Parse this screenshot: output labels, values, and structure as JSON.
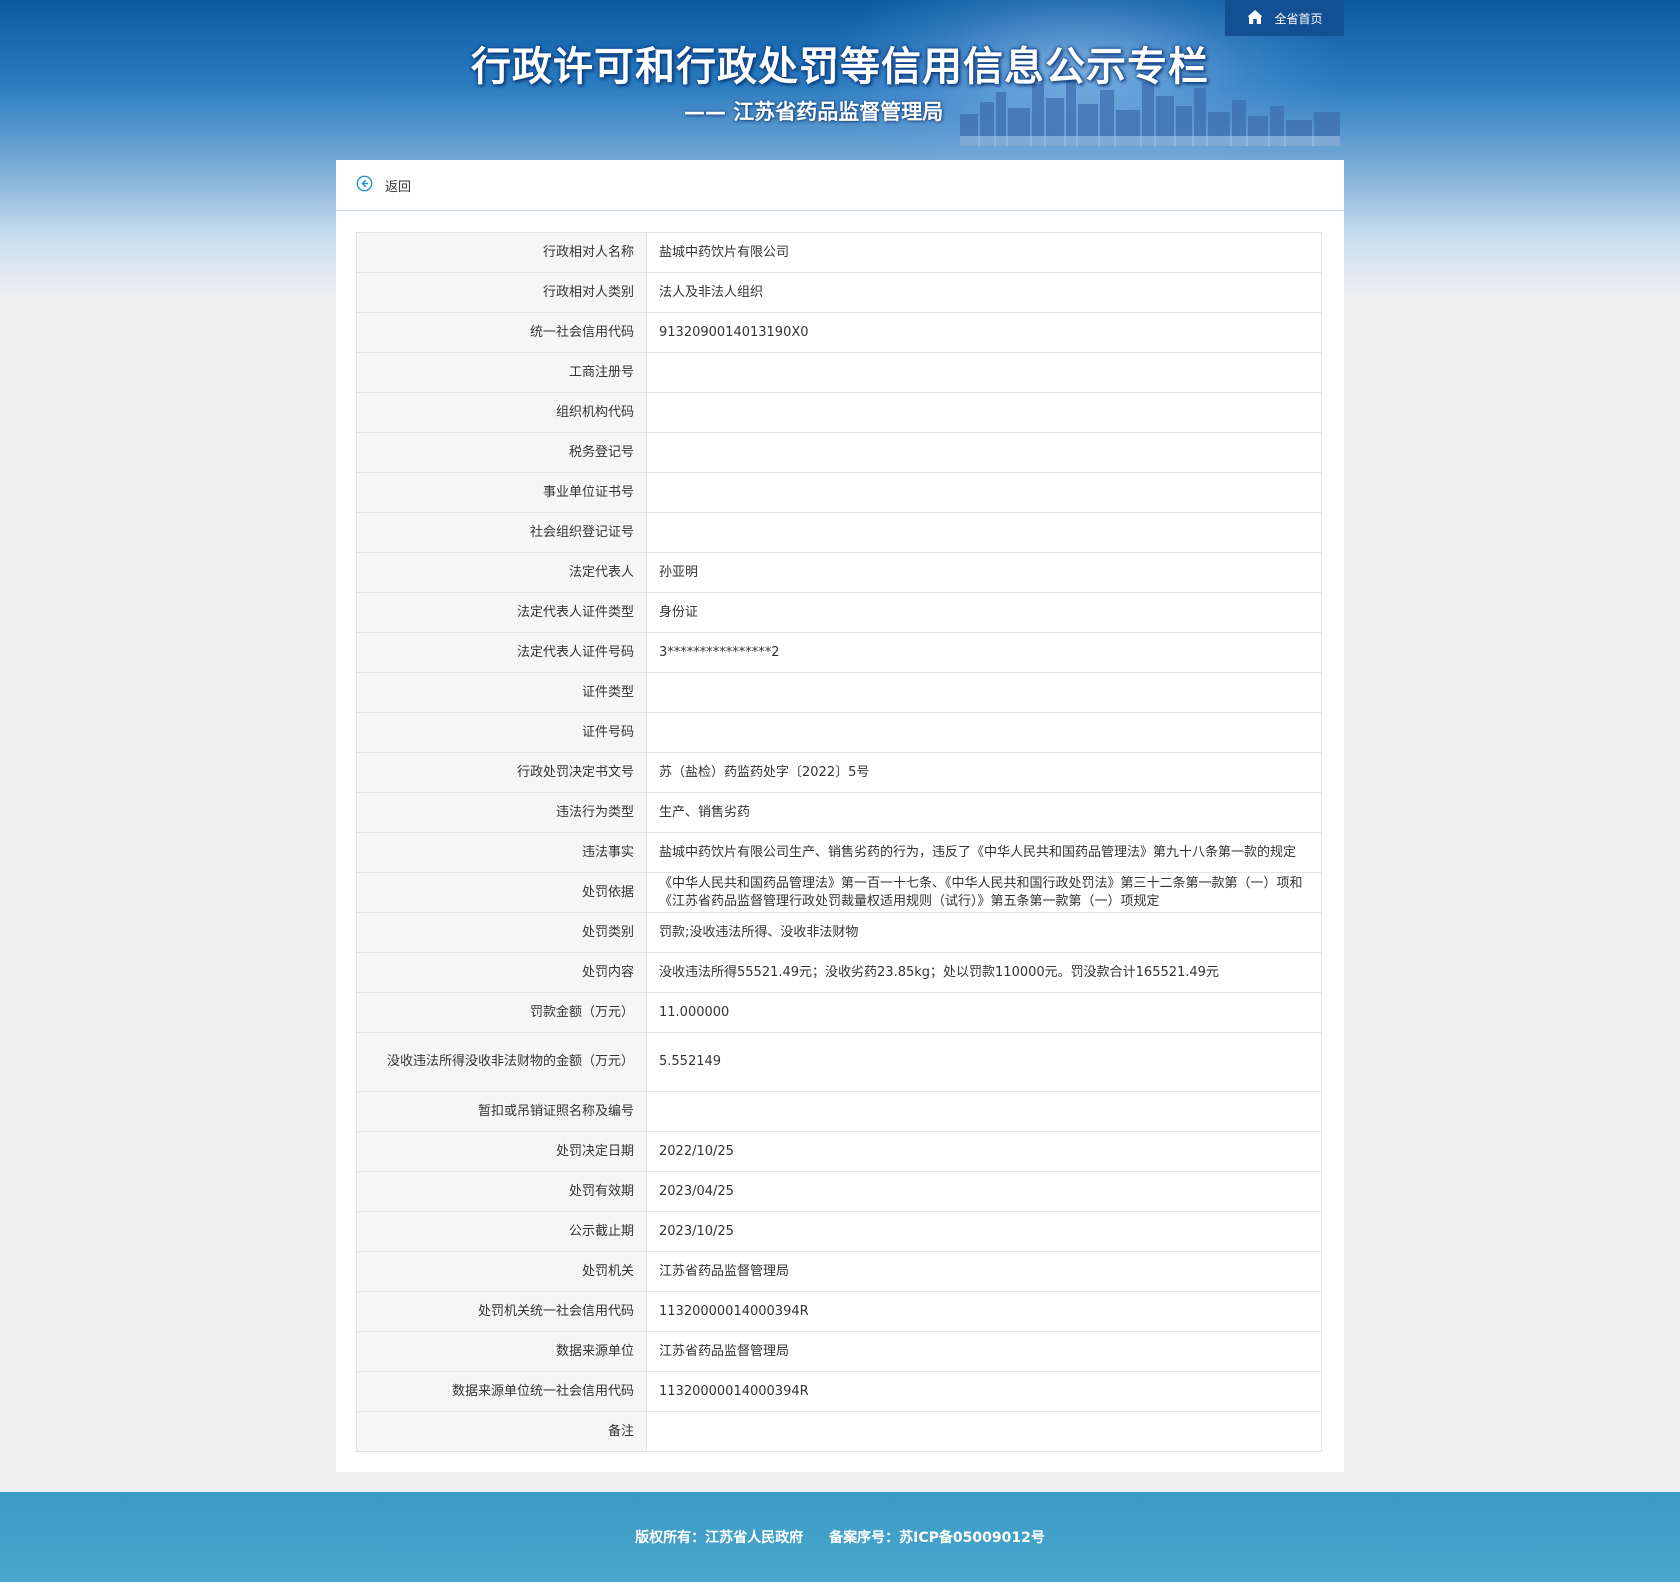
{
  "header": {
    "title": "行政许可和行政处罚等信用信息公示专栏",
    "subtitle": "—— 江苏省药品监督管理局",
    "home_label": "全省首页",
    "home_icon": "home-icon"
  },
  "back": {
    "label": "返回",
    "icon": "back-arrow-icon"
  },
  "rows": [
    {
      "label": "行政相对人名称",
      "value": "盐城中药饮片有限公司"
    },
    {
      "label": "行政相对人类别",
      "value": "法人及非法人组织"
    },
    {
      "label": "统一社会信用代码",
      "value": "9132090014013190X0"
    },
    {
      "label": "工商注册号",
      "value": ""
    },
    {
      "label": "组织机构代码",
      "value": ""
    },
    {
      "label": "税务登记号",
      "value": ""
    },
    {
      "label": "事业单位证书号",
      "value": ""
    },
    {
      "label": "社会组织登记证号",
      "value": ""
    },
    {
      "label": "法定代表人",
      "value": "孙亚明"
    },
    {
      "label": "法定代表人证件类型",
      "value": "身份证"
    },
    {
      "label": "法定代表人证件号码",
      "value": "3****************2"
    },
    {
      "label": "证件类型",
      "value": ""
    },
    {
      "label": "证件号码",
      "value": ""
    },
    {
      "label": "行政处罚决定书文号",
      "value": "苏（盐检）药监药处字〔2022〕5号"
    },
    {
      "label": "违法行为类型",
      "value": "生产、销售劣药"
    },
    {
      "label": "违法事实",
      "value": "盐城中药饮片有限公司生产、销售劣药的行为，违反了《中华人民共和国药品管理法》第九十八条第一款的规定"
    },
    {
      "label": "处罚依据",
      "value": "《中华人民共和国药品管理法》第一百一十七条、《中华人民共和国行政处罚法》第三十二条第一款第（一）项和《江苏省药品监督管理行政处罚裁量权适用规则（试行）》第五条第一款第（一）项规定"
    },
    {
      "label": "处罚类别",
      "value": "罚款;没收违法所得、没收非法财物"
    },
    {
      "label": "处罚内容",
      "value": "没收违法所得55521.49元；没收劣药23.85kg；处以罚款110000元。罚没款合计165521.49元"
    },
    {
      "label": "罚款金额（万元）",
      "value": "11.000000"
    },
    {
      "label": "没收违法所得没收非法财物的金额（万元）",
      "value": "5.552149"
    },
    {
      "label": "暂扣或吊销证照名称及编号",
      "value": ""
    },
    {
      "label": "处罚决定日期",
      "value": "2022/10/25"
    },
    {
      "label": "处罚有效期",
      "value": "2023/04/25"
    },
    {
      "label": "公示截止期",
      "value": "2023/10/25"
    },
    {
      "label": "处罚机关",
      "value": "江苏省药品监督管理局"
    },
    {
      "label": "处罚机关统一社会信用代码",
      "value": "11320000014000394R"
    },
    {
      "label": "数据来源单位",
      "value": "江苏省药品监督管理局"
    },
    {
      "label": "数据来源单位统一社会信用代码",
      "value": "11320000014000394R"
    },
    {
      "label": "备注",
      "value": ""
    }
  ],
  "footer": {
    "copyright": "版权所有：江苏省人民政府",
    "icp": "备案序号：苏ICP备05009012号"
  },
  "colors": {
    "banner_blue": "#0a5aa0",
    "home_bg": "#134f93",
    "footer_bg": "#3a9bc4",
    "label_bg": "#f6f6f6"
  }
}
